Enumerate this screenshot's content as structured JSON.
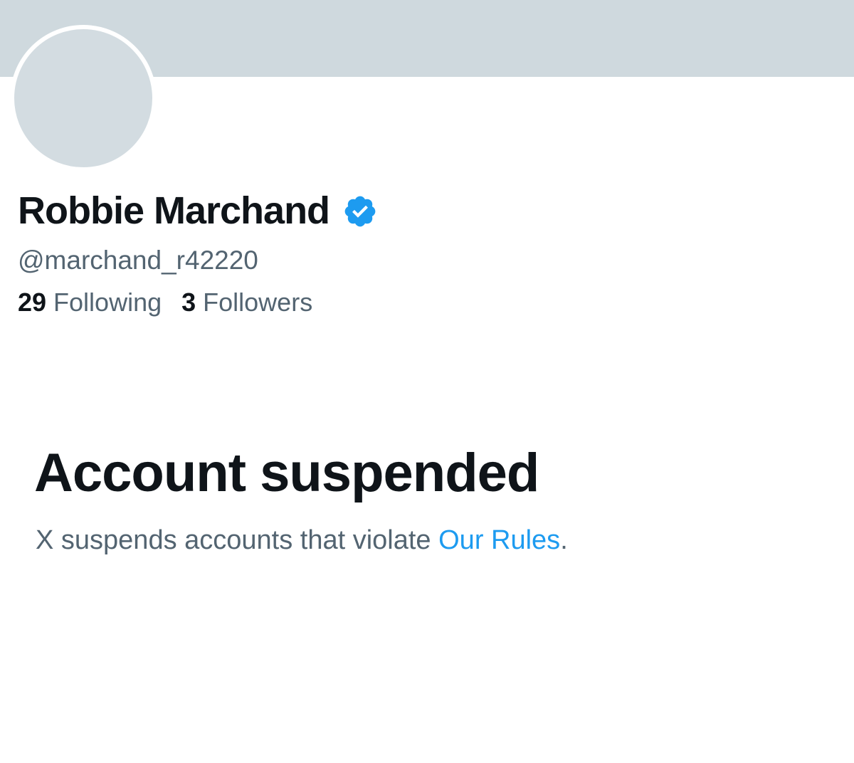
{
  "profile": {
    "display_name": "Robbie Marchand",
    "verified_icon": "verified-badge-icon",
    "handle": "@marchand_r42220"
  },
  "stats": {
    "following_count": "29",
    "following_label": "Following",
    "followers_count": "3",
    "followers_label": "Followers"
  },
  "suspension": {
    "title": "Account suspended",
    "description_prefix": "X suspends accounts that violate ",
    "rules_link": "Our Rules",
    "description_suffix": "."
  },
  "colors": {
    "banner": "#cfd9de",
    "avatar": "#d3dce1",
    "verified": "#1d9bf0",
    "link": "#1d9bf0",
    "secondary_text": "#536471",
    "primary_text": "#0f1419"
  }
}
